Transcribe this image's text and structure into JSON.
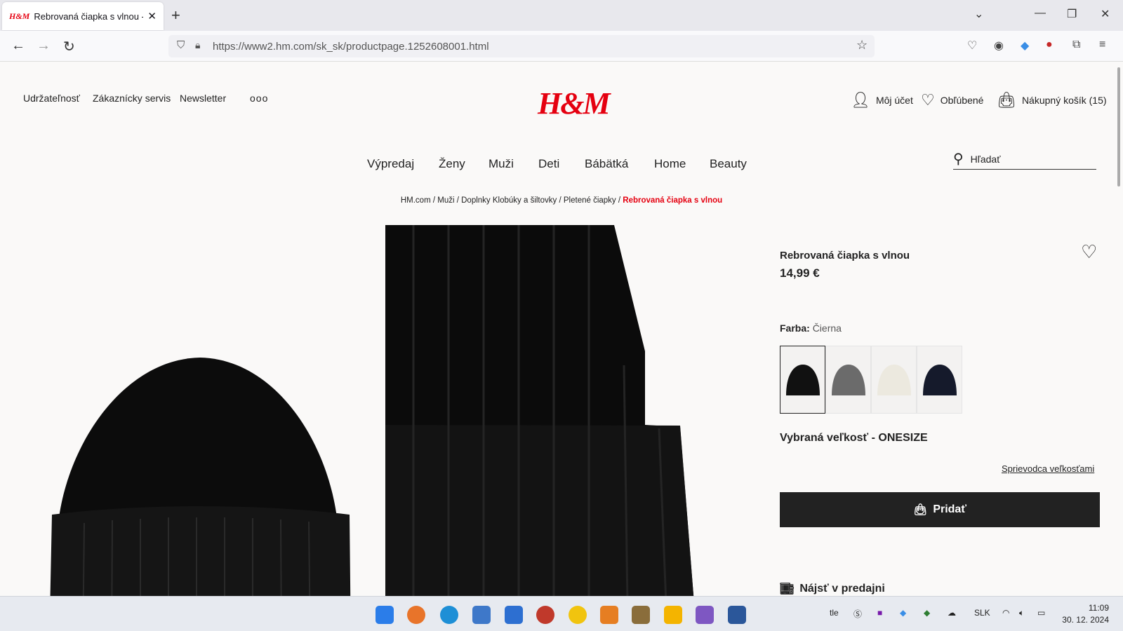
{
  "browser": {
    "tab_title": "Rebrovaná čiapka s vlnou - Čierna",
    "tab_favicon": "H&M",
    "url": "https://www2.hm.com/sk_sk/productpage.1252608001.html"
  },
  "header": {
    "top_links": [
      "Udržateľnosť",
      "Zákaznícky servis",
      "Newsletter"
    ],
    "more": "ooo",
    "logo": "H&M",
    "account": "Môj účet",
    "favorites": "Obľúbené",
    "cart": "Nákupný košík (15)"
  },
  "nav": {
    "items": [
      "Výpredaj",
      "Ženy",
      "Muži",
      "Deti",
      "Bábätká",
      "Home",
      "Beauty"
    ],
    "search_placeholder": "Hľadať"
  },
  "breadcrumb": {
    "items": [
      "HM.com",
      "Muži",
      "Doplnky Klobúky a šiltovky",
      "Pletené čiapky"
    ],
    "current": "Rebrovaná čiapka s vlnou"
  },
  "product": {
    "title": "Rebrovaná čiapka s vlnou",
    "price": "14,99 €",
    "color_label": "Farba:",
    "color_value": "Čierna",
    "swatch_colors": [
      "#111111",
      "#6b6b6b",
      "#ece9df",
      "#151a2b"
    ],
    "selected_swatch": 0,
    "size_label": "Vybraná veľkosť - ONESIZE",
    "size_guide": "Sprievodca veľkosťami",
    "add_button": "Pridať",
    "find_store": "Nájsť v predajni"
  },
  "taskbar": {
    "tray_lang": "SLK",
    "tray_text": "tle",
    "time": "11:09",
    "date": "30. 12. 2024"
  },
  "colors": {
    "brand": "#e50010",
    "button": "#222222"
  }
}
